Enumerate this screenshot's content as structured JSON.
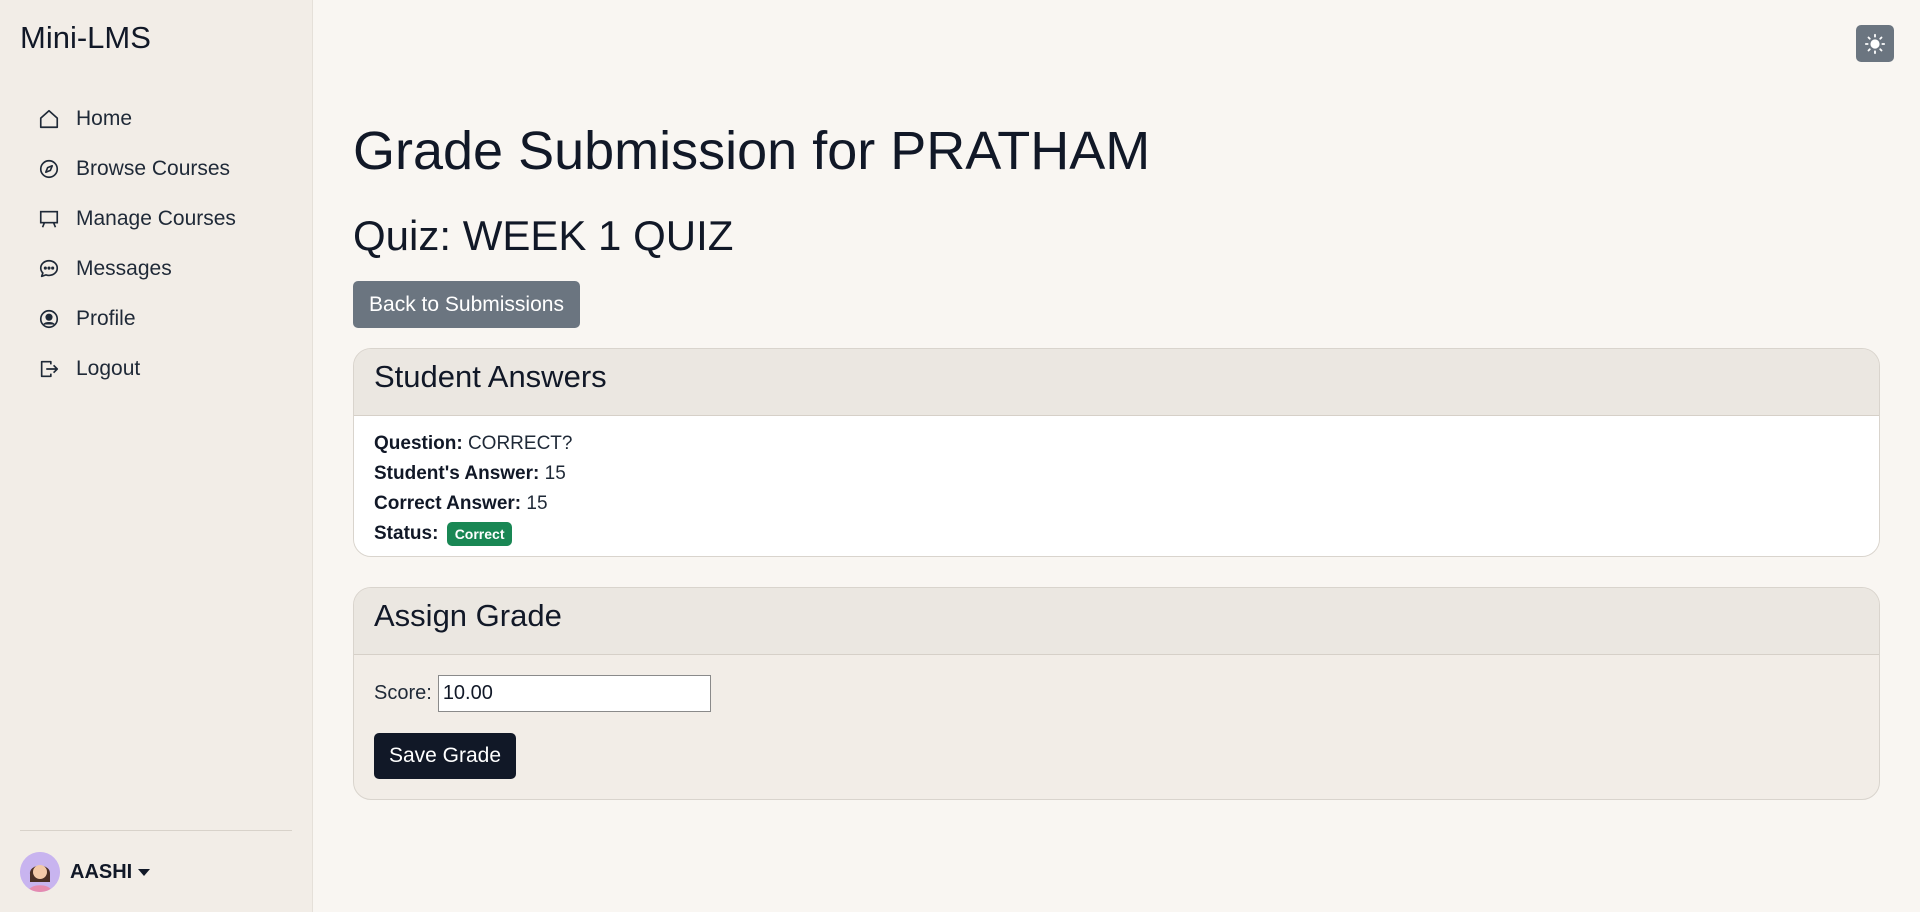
{
  "app": {
    "brand": "Mini-LMS"
  },
  "sidebar": {
    "items": [
      {
        "label": "Home",
        "icon": "home-icon"
      },
      {
        "label": "Browse Courses",
        "icon": "compass-icon"
      },
      {
        "label": "Manage Courses",
        "icon": "easel-icon"
      },
      {
        "label": "Messages",
        "icon": "chat-icon"
      },
      {
        "label": "Profile",
        "icon": "user-circle-icon"
      },
      {
        "label": "Logout",
        "icon": "logout-icon"
      }
    ],
    "user": {
      "name": "AASHI"
    }
  },
  "header": {
    "theme_toggle_icon": "sun-icon"
  },
  "main": {
    "title": "Grade Submission for PRATHAM",
    "quiz_title": "Quiz: WEEK 1 QUIZ",
    "back_button": "Back to Submissions",
    "answers_card": {
      "title": "Student Answers",
      "question_label": "Question:",
      "question_value": "CORRECT?",
      "student_answer_label": "Student's Answer:",
      "student_answer_value": "15",
      "correct_answer_label": "Correct Answer:",
      "correct_answer_value": "15",
      "status_label": "Status:",
      "status_value": "Correct"
    },
    "grade_card": {
      "title": "Assign Grade",
      "score_label": "Score:",
      "score_value": "10.00",
      "save_button": "Save Grade"
    }
  },
  "colors": {
    "accent_dark": "#111827",
    "secondary_button": "#6b7580",
    "success_badge": "#198754",
    "sidebar_bg": "#f2ede7",
    "page_bg": "#f9f6f2"
  }
}
